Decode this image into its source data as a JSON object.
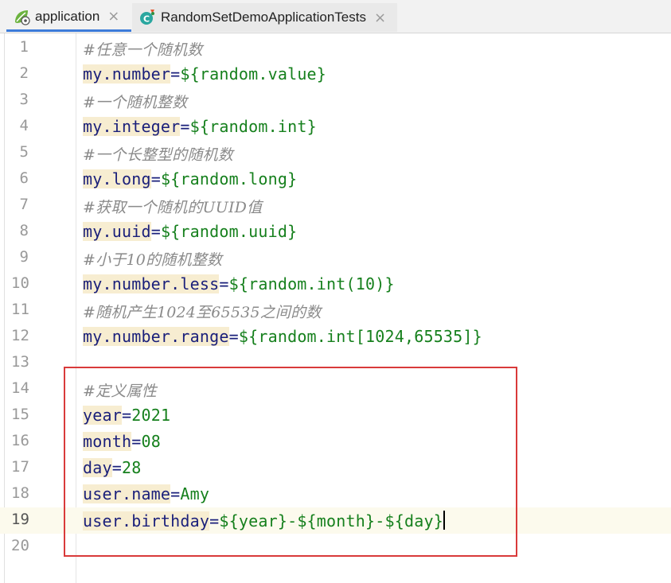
{
  "tabs": [
    {
      "label": "application",
      "close": "×",
      "icon": "spring-leaf-icon"
    },
    {
      "label": "RandomSetDemoApplicationTests",
      "close": "×",
      "icon": "test-class-icon"
    }
  ],
  "editor": {
    "current_line": 19,
    "lines": [
      {
        "n": "1",
        "type": "comment",
        "text": "#任意一个随机数"
      },
      {
        "n": "2",
        "type": "kv",
        "key": "my.number",
        "eq": "=",
        "value": "${random.value}"
      },
      {
        "n": "3",
        "type": "comment",
        "text": "#一个随机整数"
      },
      {
        "n": "4",
        "type": "kv",
        "key": "my.integer",
        "eq": "=",
        "value": "${random.int}"
      },
      {
        "n": "5",
        "type": "comment",
        "text": "#一个长整型的随机数"
      },
      {
        "n": "6",
        "type": "kv",
        "key": "my.long",
        "eq": "=",
        "value": "${random.long}"
      },
      {
        "n": "7",
        "type": "comment",
        "text": "#获取一个随机的UUID值"
      },
      {
        "n": "8",
        "type": "kv",
        "key": "my.uuid",
        "eq": "=",
        "value": "${random.uuid}"
      },
      {
        "n": "9",
        "type": "comment",
        "text": "#小于10的随机整数"
      },
      {
        "n": "10",
        "type": "kv",
        "key": "my.number.less",
        "eq": "=",
        "value": "${random.int(10)}"
      },
      {
        "n": "11",
        "type": "comment",
        "text": "#随机产生1024至65535之间的数"
      },
      {
        "n": "12",
        "type": "kv",
        "key": "my.number.range",
        "eq": "=",
        "value": "${random.int[1024,65535]}"
      },
      {
        "n": "13",
        "type": "empty"
      },
      {
        "n": "14",
        "type": "comment",
        "text": "#定义属性"
      },
      {
        "n": "15",
        "type": "kv",
        "key": "year",
        "eq": "=",
        "value": "2021"
      },
      {
        "n": "16",
        "type": "kv",
        "key": "month",
        "eq": "=",
        "value": "08"
      },
      {
        "n": "17",
        "type": "kv",
        "key": "day",
        "eq": "=",
        "value": "28"
      },
      {
        "n": "18",
        "type": "kv",
        "key": "user.name",
        "eq": "=",
        "value": "Amy"
      },
      {
        "n": "19",
        "type": "kv",
        "key": "user.birthday",
        "eq": "=",
        "value": "${year}-${month}-${day}"
      },
      {
        "n": "20",
        "type": "empty"
      }
    ]
  },
  "colors": {
    "key": "#1a1f7a",
    "value": "#16801d",
    "comment": "#8a8a8a",
    "key_bg": "#f7edd1",
    "highlight_box": "#d93a3a",
    "active_tab_underline": "#3d7bd9"
  }
}
